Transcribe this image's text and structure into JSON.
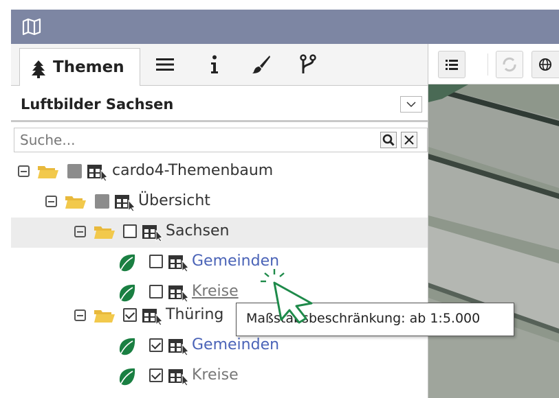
{
  "titlebar": {
    "icon": "map-icon"
  },
  "tabs": {
    "active": {
      "icon": "tree-icon",
      "label": "Themen"
    },
    "others": [
      "list-icon",
      "info-icon",
      "brush-icon",
      "branch-icon"
    ]
  },
  "layer_select": {
    "value": "Luftbilder Sachsen"
  },
  "search": {
    "placeholder": "Suche..."
  },
  "tree": [
    {
      "label": "cardo4-Themenbaum",
      "expanded": true,
      "state": "partial"
    },
    {
      "label": "Übersicht",
      "expanded": true,
      "state": "partial"
    },
    {
      "label": "Sachsen",
      "expanded": true,
      "state": "unchecked",
      "selected": true
    },
    {
      "label": "Gemeinden",
      "state": "unchecked",
      "style": "link"
    },
    {
      "label": "Kreise",
      "state": "unchecked",
      "style": "underlined"
    },
    {
      "label": "Thüring",
      "expanded": true,
      "state": "checked"
    },
    {
      "label": "Gemeinden",
      "state": "checked",
      "style": "link"
    },
    {
      "label": "Kreise",
      "state": "checked",
      "style": "muted"
    }
  ],
  "tooltip": {
    "text": "Maßstabsbeschränkung: ab 1:5.000"
  },
  "colors": {
    "titlebar": "#7d86a3",
    "folder": "#f2c94c",
    "leaf": "#1a7f42",
    "link": "#4a63b7"
  }
}
